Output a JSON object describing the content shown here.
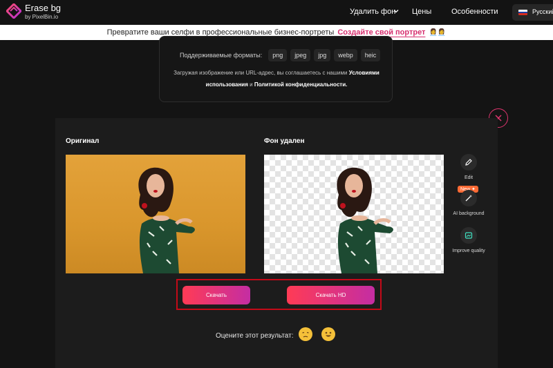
{
  "header": {
    "logo_title": "Erase bg",
    "logo_sub": "by PixelBin.io",
    "nav": [
      "Удалить фон",
      "Цены",
      "Особенности"
    ],
    "language": "Русский"
  },
  "promo": {
    "text": "Превратите ваши селфи в профессиональные бизнес-портреты",
    "link": "Создайте свой портрет",
    "emoji": "👩‍💼👩‍💼"
  },
  "upload": {
    "formats_label": "Поддерживаемые форматы:",
    "formats": [
      "png",
      "jpeg",
      "jpg",
      "webp",
      "heic"
    ],
    "terms_prefix": "Загружая изображение или URL-адрес, вы соглашаетесь с нашими",
    "terms_link": "Условиями использования",
    "terms_and": "и",
    "privacy_link": "Политикой конфиденциальности."
  },
  "result": {
    "original_label": "Оригинал",
    "removed_label": "Фон удален",
    "tools": {
      "edit": "Edit",
      "ai_background": "AI background",
      "new_badge": "New ✦",
      "improve_quality": "Improve quality"
    },
    "download": "Скачать",
    "download_hd": "Скачать HD",
    "rate_prompt": "Оцените этот результат:"
  },
  "colors": {
    "accent": "#e0356f",
    "highlight_border": "#c40a18",
    "button_gradient": [
      "#ff3b55",
      "#c42da3"
    ]
  }
}
